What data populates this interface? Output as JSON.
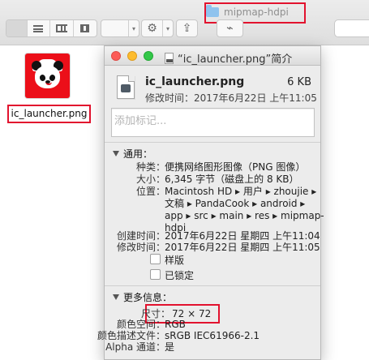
{
  "finder": {
    "path_title": "mipmap-hdpi",
    "toolbar": {
      "arrange_glyph": "▾",
      "action_glyph": "▾",
      "share_glyph": "⇪",
      "tag_glyph": "⌁"
    }
  },
  "desktop": {
    "file_name": "ic_launcher.png"
  },
  "info_window": {
    "title": "“ic_launcher.png”简介",
    "name": "ic_launcher.png",
    "size_short": "6 KB",
    "modified_summary": "修改时间：2017年6月22日 上午11:05",
    "tag_placeholder": "添加标记...",
    "general": {
      "title": "通用：",
      "kind_label": "种类：",
      "kind_value": "便携网络图形图像（PNG 图像）",
      "size_label": "大小：",
      "size_value": "6,345 字节（磁盘上的 8 KB）",
      "location_label": "位置：",
      "location_lines": [
        "Macintosh HD ▸ 用户 ▸ zhoujie ▸",
        "文稿 ▸ PandaCook ▸ android ▸",
        "app ▸ src ▸ main ▸ res ▸ mipmap-",
        "hdpi"
      ],
      "created_label": "创建时间：",
      "created_value": "2017年6月22日 星期四 上午11:04",
      "modified_label": "修改时间：",
      "modified_value": "2017年6月22日 星期四 上午11:05",
      "stationery_label": "样版",
      "locked_label": "已锁定"
    },
    "more_info": {
      "title": "更多信息：",
      "dimensions_label": "尺寸：",
      "dimensions_value": "72 × 72",
      "color_space_label": "颜色空间：",
      "color_space_value": "RGB",
      "profile_label": "颜色描述文件：",
      "profile_value": "sRGB IEC61966-2.1",
      "alpha_label": "Alpha 通道：",
      "alpha_value": "是"
    }
  },
  "colors": {
    "highlight": "#e2122e",
    "desktop_icon_red": "#ec0f19",
    "window_bg": "#ececec"
  }
}
